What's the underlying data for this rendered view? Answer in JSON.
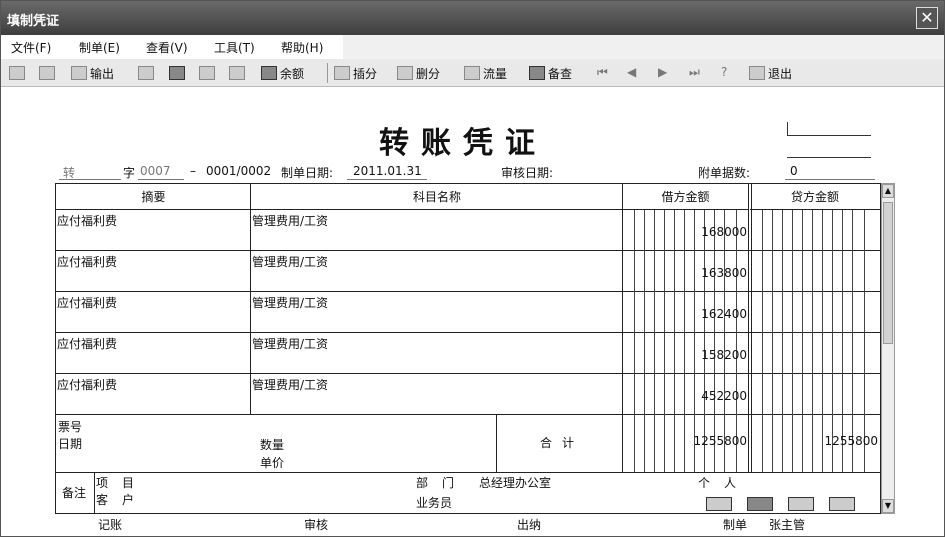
{
  "window": {
    "title": "填制凭证",
    "close_label": "✕"
  },
  "menu": [
    "文件(F)",
    "制单(E)",
    "查看(V)",
    "工具(T)",
    "帮助(H)"
  ],
  "toolbar": {
    "output": "输出",
    "balance": "余额",
    "insert": "插分",
    "delete": "删分",
    "flow": "流量",
    "check": "备查",
    "exit": "退出"
  },
  "voucher": {
    "title": "转账凭证",
    "type": "转",
    "zi_label": "字",
    "number": "0007",
    "dash": "–",
    "sub_number": "0001/0002",
    "date_label": "制单日期:",
    "date": "2011.01.31",
    "audit_label": "审核日期:",
    "attach_label": "附单据数:",
    "attach_count": "0"
  },
  "table": {
    "headers": {
      "summary": "摘要",
      "account": "科目名称",
      "debit": "借方金额",
      "credit": "贷方金额"
    },
    "rows": [
      {
        "summary": "应付福利费",
        "account": "管理费用/工资",
        "debit": "168000",
        "credit": ""
      },
      {
        "summary": "应付福利费",
        "account": "管理费用/工资",
        "debit": "163800",
        "credit": ""
      },
      {
        "summary": "应付福利费",
        "account": "管理费用/工资",
        "debit": "162400",
        "credit": ""
      },
      {
        "summary": "应付福利费",
        "account": "管理费用/工资",
        "debit": "158200",
        "credit": ""
      },
      {
        "summary": "应付福利费",
        "account": "管理费用/工资",
        "debit": "452200",
        "credit": ""
      }
    ],
    "ticket_label": "票号",
    "date_label": "日期",
    "qty_label": "数量",
    "price_label": "单价",
    "total_label": "合计",
    "total_debit": "1255800",
    "total_credit": "1255800"
  },
  "remarks": {
    "label": "备注",
    "project_label": "项目",
    "customer_label": "客户",
    "dept_label": "部门",
    "dept_value": "总经理办公室",
    "person_label": "个人",
    "salesman_label": "业务员"
  },
  "footer": {
    "bookkeeping": "记账",
    "review": "审核",
    "cashier": "出纳",
    "maker_label": "制单",
    "maker": "张主管"
  }
}
